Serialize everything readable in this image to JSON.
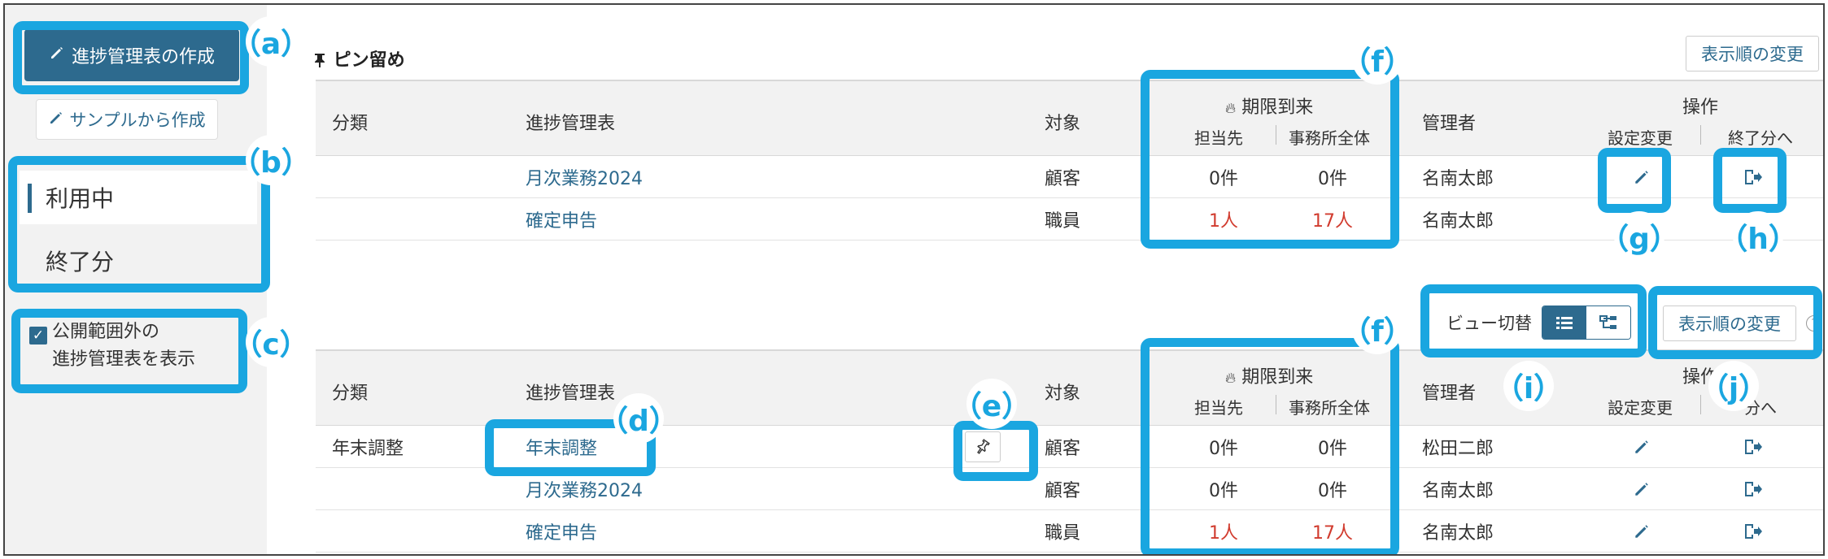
{
  "sidebar": {
    "create_label": "進捗管理表の作成",
    "sample_label": "サンプルから作成",
    "menu": [
      "利用中",
      "終了分"
    ],
    "show_private_line1": "公開範囲外の",
    "show_private_line2": "進捗管理表を表示"
  },
  "pinned": {
    "title": "ピン留め",
    "order_label": "表示順の変更",
    "headers": {
      "category": "分類",
      "table": "進捗管理表",
      "target": "対象",
      "deadline": "期限到来",
      "assignee": "担当先",
      "office": "事務所全体",
      "manager": "管理者",
      "ops": "操作",
      "settings": "設定変更",
      "to_ended": "終了分へ"
    },
    "rows": [
      {
        "category": "",
        "name": "月次業務2024",
        "target": "顧客",
        "assignee": "0件",
        "office": "0件",
        "manager": "名南太郎"
      },
      {
        "category": "",
        "name": "確定申告",
        "target": "職員",
        "assignee": "1人",
        "office": "17人",
        "manager": "名南太郎"
      }
    ]
  },
  "list": {
    "view_switch_label": "ビュー切替",
    "order_label": "表示順の変更",
    "headers": {
      "category": "分類",
      "table": "進捗管理表",
      "target": "対象",
      "deadline": "期限到来",
      "assignee": "担当先",
      "office": "事務所全体",
      "manager": "管理者",
      "ops": "操作",
      "settings": "設定変更",
      "to_ended": "分へ"
    },
    "rows": [
      {
        "category": "年末調整",
        "name": "年末調整",
        "target": "顧客",
        "assignee": "0件",
        "office": "0件",
        "manager": "松田二郎"
      },
      {
        "category": "",
        "name": "月次業務2024",
        "target": "顧客",
        "assignee": "0件",
        "office": "0件",
        "manager": "名南太郎"
      },
      {
        "category": "",
        "name": "確定申告",
        "target": "職員",
        "assignee": "1人",
        "office": "17人",
        "manager": "名南太郎"
      }
    ]
  },
  "callouts": {
    "a": "（a）",
    "b": "（b）",
    "c": "（c）",
    "d": "（d）",
    "e": "（e）",
    "f1": "（f）",
    "f2": "（f）",
    "g": "（g）",
    "h": "（h）",
    "i": "（i）",
    "j": "（j）"
  },
  "colors": {
    "accent": "#2d6a8e",
    "callout": "#1aa6e0",
    "alert": "#d13b2e"
  }
}
